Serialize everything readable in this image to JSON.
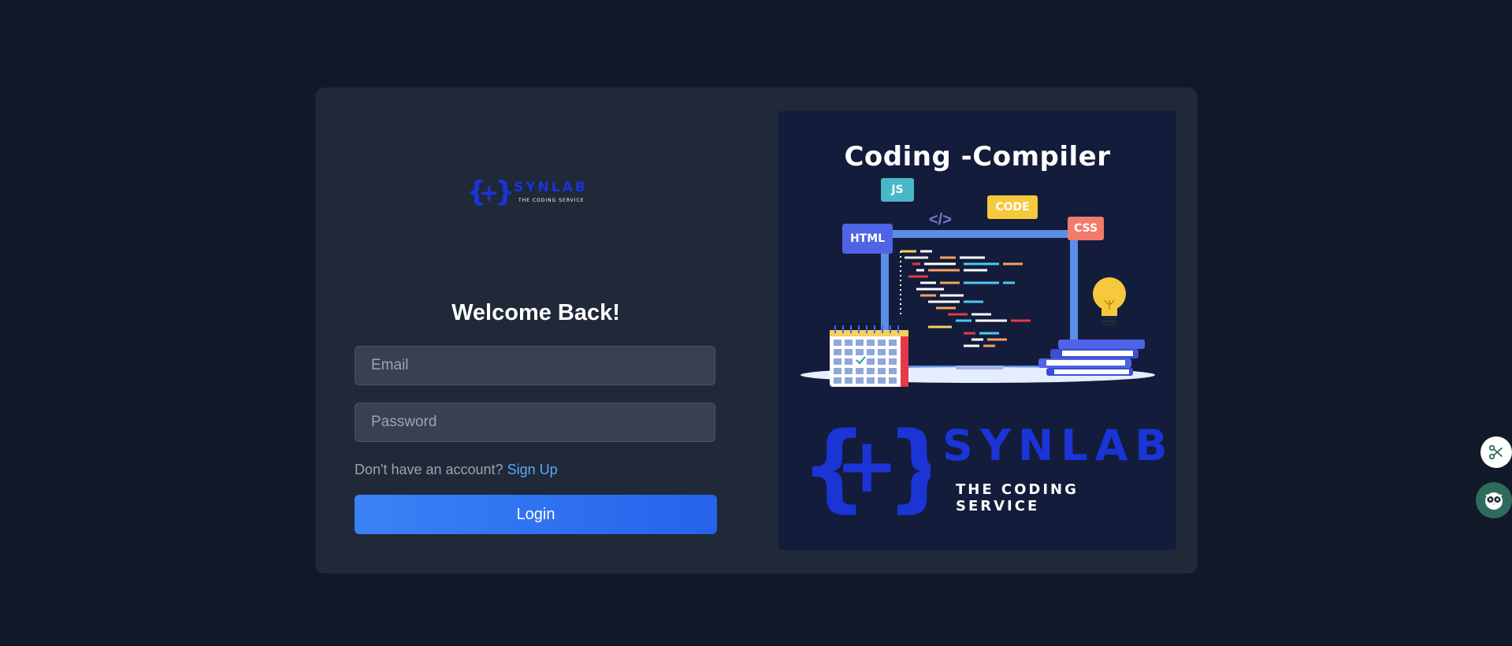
{
  "form": {
    "title": "Welcome Back!",
    "email_placeholder": "Email",
    "password_placeholder": "Password",
    "signup_prompt": "Don't have an account?",
    "signup_link": "Sign Up",
    "login_label": "Login"
  },
  "logo_small": {
    "name": "SYNLAB",
    "tagline": "THE CODING SERVICE"
  },
  "promo": {
    "title": "Coding -Compiler",
    "tags": [
      "JS",
      "CODE",
      "HTML",
      "CSS",
      "</>"
    ],
    "brand_name": "SYNLAB",
    "brand_tagline": "THE CODING SERVICE"
  },
  "floating_buttons": [
    "scissors-icon",
    "owl-icon"
  ],
  "colors": {
    "background": "#111827",
    "card": "#1f2937",
    "input": "#374151",
    "accent": "#3b82f6",
    "link": "#60a5fa",
    "brand": "#1a34d6"
  }
}
